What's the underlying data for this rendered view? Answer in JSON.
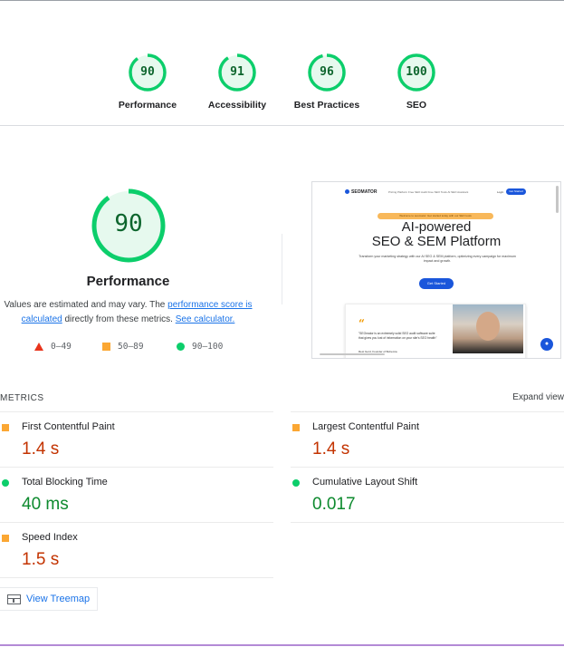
{
  "summary": {
    "gauges": [
      {
        "score": "90",
        "label": "Performance",
        "fraction": 0.9
      },
      {
        "score": "91",
        "label": "Accessibility",
        "fraction": 0.91
      },
      {
        "score": "96",
        "label": "Best Practices",
        "fraction": 0.96
      },
      {
        "score": "100",
        "label": "SEO",
        "fraction": 1.0
      }
    ]
  },
  "performance": {
    "score": "90",
    "fraction": 0.9,
    "title": "Performance",
    "note_prefix": "Values are estimated and may vary. The ",
    "note_link1": "performance score is calculated",
    "note_mid": " directly from these metrics. ",
    "note_link2": "See calculator.",
    "legend": {
      "fail": "0–49",
      "average": "50–89",
      "pass": "90–100"
    }
  },
  "screenshot": {
    "logo": "SEOMATOR",
    "nav_links": "Pricing   Platform   Free SEO Audit   Free SEO Tools   AI SEO Assistant",
    "login": "Login",
    "nav_cta": "Get Started",
    "pill": "Welcome to seomator: Get started today with our SEO tools",
    "headline_1": "AI-powered",
    "headline_2": "SEO & SEM Platform",
    "subtitle": "Transform your marketing strategy with our AI SEO & SEM platform, optimizing every campaign for maximum impact and growth.",
    "cta": "Get Started",
    "quote_mark": "“",
    "quote_text": "\"SEOmator is an extremely solid SEO audit software suite that gives you lost of information on your site's SEO health\"",
    "quote_name": "Rest Gerd, Founder of Bohemia"
  },
  "metrics": {
    "header": "METRICS",
    "expand": "Expand view",
    "items": [
      {
        "name": "First Contentful Paint",
        "value": "1.4 s",
        "status": "average"
      },
      {
        "name": "Largest Contentful Paint",
        "value": "1.4 s",
        "status": "average"
      },
      {
        "name": "Total Blocking Time",
        "value": "40 ms",
        "status": "pass"
      },
      {
        "name": "Cumulative Layout Shift",
        "value": "0.017",
        "status": "pass"
      },
      {
        "name": "Speed Index",
        "value": "1.5 s",
        "status": "average"
      }
    ]
  },
  "treemap": {
    "label": "View Treemap"
  },
  "colors": {
    "pass": "#0cce6b",
    "average": "#fba733",
    "fail": "#e8341c",
    "pass_text": "#0d652d",
    "average_text": "#c33300",
    "link": "#1a73e8"
  }
}
